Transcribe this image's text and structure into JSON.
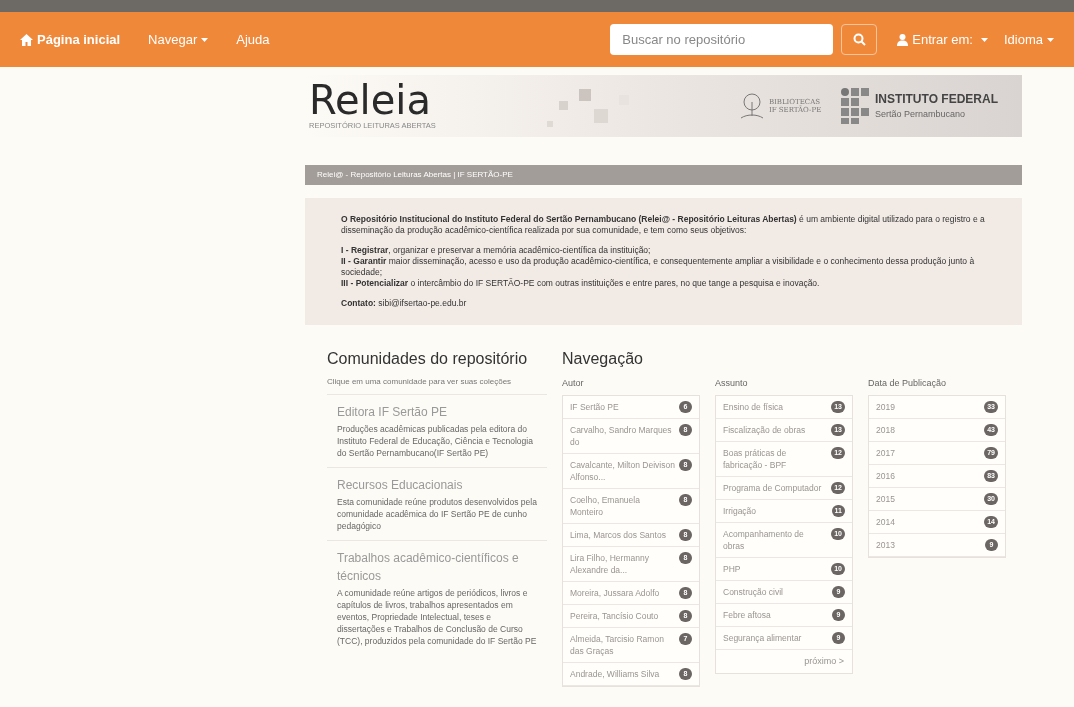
{
  "navbar": {
    "home": "Página inicial",
    "browse": "Navegar",
    "help": "Ajuda",
    "search": {
      "placeholder": "Buscar no repositório"
    },
    "login": "Entrar em:",
    "language": "Idioma"
  },
  "banner": {
    "logo": "Releia",
    "logo_subtitle": "REPOSITÓRIO LEITURAS ABERTAS",
    "library": "BIBLIOTECAS IF SERTÃO-PE",
    "institute": "INSTITUTO FEDERAL",
    "institute_subtitle": "Sertão Pernambucano"
  },
  "breadcrumb": "Relei@ - Repositório Leituras Abertas | IF SERTÃO-PE",
  "intro": {
    "paragraph": "**O Repositório Institucional do Instituto Federal do Sertão Pernambucano (Relei@ - Repositório Leituras Abertas)** é um ambiente digital utilizado para o registro e a disseminação da produção acadêmico-científica realizada por sua comunidade, e tem como seus objetivos:",
    "objectives": [
      "**I - Registrar**, organizar e preservar a memória acadêmico-científica da instituição;",
      "**II - Garantir** maior disseminação, acesso e uso da produção acadêmico-científica, e consequentemente ampliar a visibilidade e o conhecimento dessa produção junto à sociedade;",
      "**III - Potencializar** o intercâmbio do IF SERTÃO-PE com outras instituições e entre pares, no que tange a pesquisa e inovação."
    ],
    "contact": "**Contato:** sibi@ifsertao-pe.edu.br"
  },
  "communities": {
    "title": "Comunidades do repositório",
    "hint": "Clique em uma comunidade para ver suas coleções",
    "items": [
      {
        "name": "Editora IF Sertão PE",
        "description": "Produções acadêmicas publicadas pela editora do Instituto Federal de Educação, Ciência e Tecnologia do Sertão Pernambucano(IF Sertão PE)"
      },
      {
        "name": "Recursos Educacionais",
        "description": "Esta comunidade reúne produtos desenvolvidos pela comunidade acadêmica do IF Sertão PE de cunho pedagógico"
      },
      {
        "name": "Trabalhos acadêmico-científicos e técnicos",
        "description": "A comunidade reúne artigos de periódicos, livros e capítulos de livros, trabalhos apresentados em eventos, Propriedade Intelectual, teses e dissertações e Trabalhos de Conclusão de Curso (TCC), produzidos pela comunidade do IF Sertão PE"
      }
    ]
  },
  "navigation": {
    "title": "Navegação",
    "facets": [
      {
        "label": "Autor",
        "items": [
          {
            "name": "IF Sertão PE",
            "count": "6"
          },
          {
            "name": "Carvalho, Sandro Marques do",
            "count": "8"
          },
          {
            "name": "Cavalcante, Milton Deivison Alfonso...",
            "count": "8"
          },
          {
            "name": "Coelho, Emanuela Monteiro",
            "count": "8"
          },
          {
            "name": "Lima, Marcos dos Santos",
            "count": "8"
          },
          {
            "name": "Lira Filho, Hermanny Alexandre da...",
            "count": "8"
          },
          {
            "name": "Moreira, Jussara Adolfo",
            "count": "8"
          },
          {
            "name": "Pereira, Tancísio Couto",
            "count": "8"
          },
          {
            "name": "Almeida, Tarcisio Ramon das Graças",
            "count": "7"
          },
          {
            "name": "Andrade, Williams Silva",
            "count": "8"
          }
        ]
      },
      {
        "label": "Assunto",
        "items": [
          {
            "name": "Ensino de física",
            "count": "13"
          },
          {
            "name": "Fiscalização de obras",
            "count": "13"
          },
          {
            "name": "Boas práticas de fabricação - BPF",
            "count": "12"
          },
          {
            "name": "Programa de Computador",
            "count": "12"
          },
          {
            "name": "Irrigação",
            "count": "11"
          },
          {
            "name": "Acompanhamento de obras",
            "count": "10"
          },
          {
            "name": "PHP",
            "count": "10"
          },
          {
            "name": "Construção civil",
            "count": "9"
          },
          {
            "name": "Febre aftosa",
            "count": "9"
          },
          {
            "name": "Segurança alimentar",
            "count": "9"
          }
        ],
        "next": "próximo >"
      },
      {
        "label": "Data de Publicação",
        "items": [
          {
            "name": "2019",
            "count": "33"
          },
          {
            "name": "2018",
            "count": "43"
          },
          {
            "name": "2017",
            "count": "79"
          },
          {
            "name": "2016",
            "count": "83"
          },
          {
            "name": "2015",
            "count": "30"
          },
          {
            "name": "2014",
            "count": "14"
          },
          {
            "name": "2013",
            "count": "9"
          }
        ]
      }
    ]
  }
}
